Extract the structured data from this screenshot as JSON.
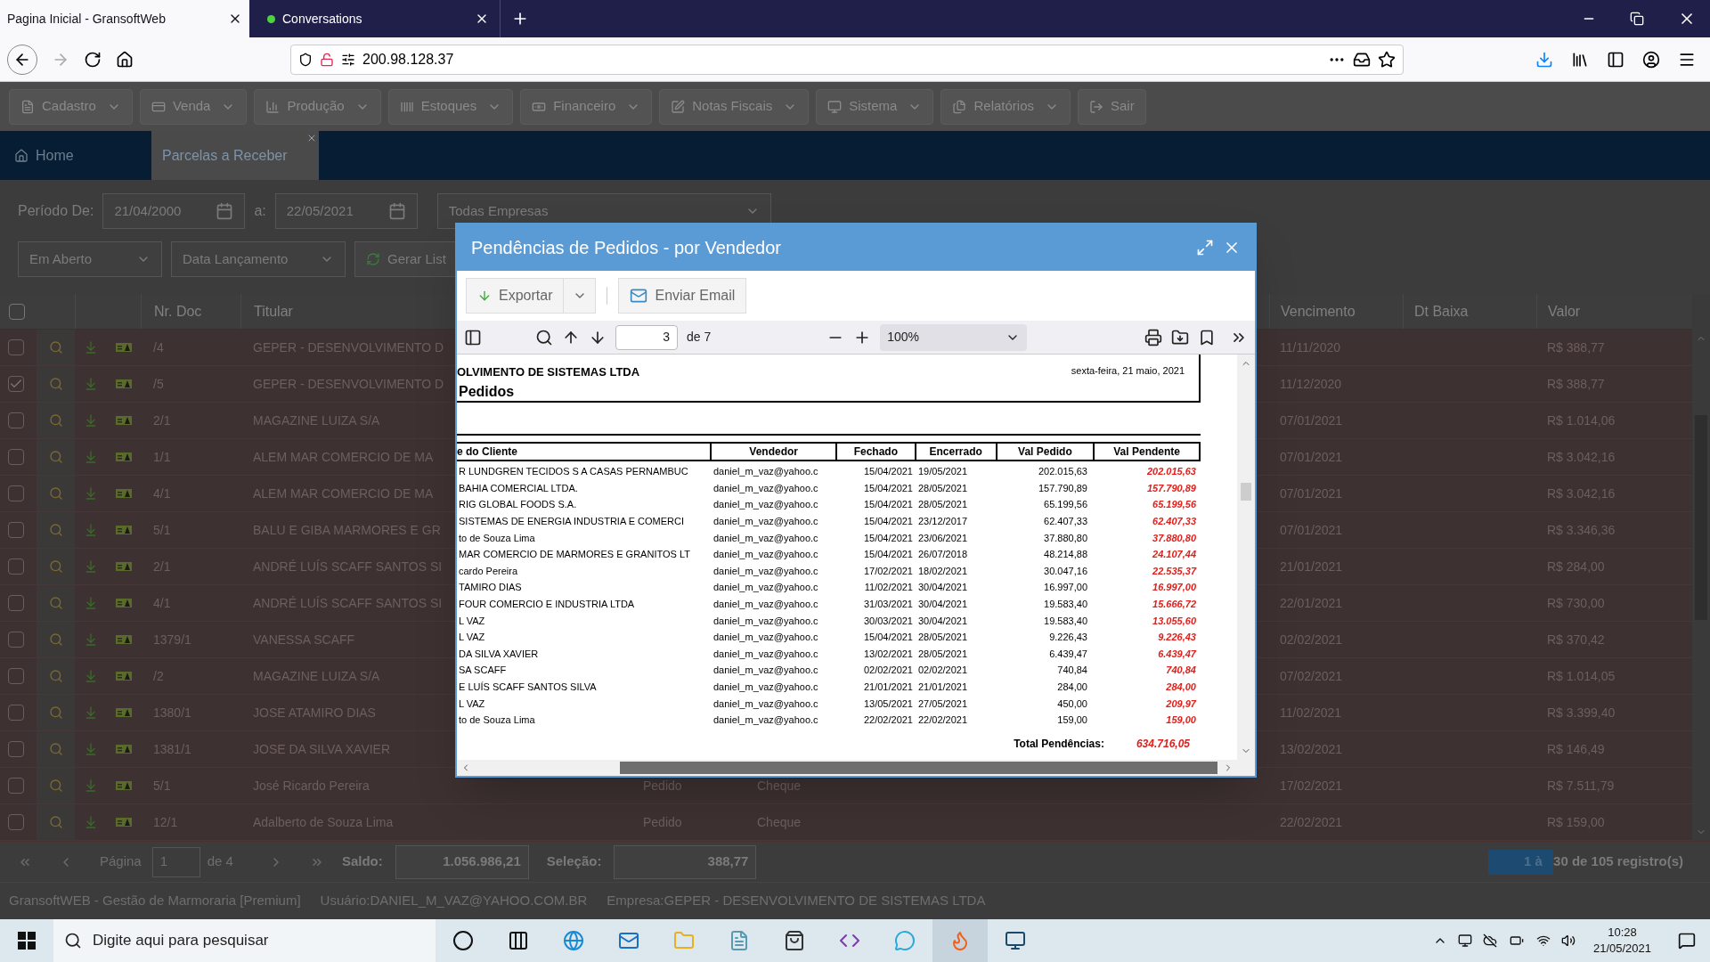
{
  "browser": {
    "tabs": [
      {
        "title": "Pagina Inicial - GransoftWeb",
        "selected": true
      },
      {
        "title": "Conversations",
        "selected": false
      }
    ],
    "address": "200.98.128.37"
  },
  "menu": [
    {
      "label": "Cadastro",
      "dropdown": true
    },
    {
      "label": "Venda",
      "dropdown": true
    },
    {
      "label": "Produção",
      "dropdown": true
    },
    {
      "label": "Estoques",
      "dropdown": true
    },
    {
      "label": "Financeiro",
      "dropdown": true
    },
    {
      "label": "Notas Fiscais",
      "dropdown": true
    },
    {
      "label": "Sistema",
      "dropdown": true
    },
    {
      "label": "Relatórios",
      "dropdown": true
    },
    {
      "label": "Sair",
      "dropdown": false
    }
  ],
  "app_tabs": [
    {
      "label": "Home",
      "selected": false,
      "closable": false
    },
    {
      "label": "Parcelas a Receber",
      "selected": true,
      "closable": true
    }
  ],
  "filters": {
    "period_label": "Período De:",
    "date_from": "21/04/2000",
    "to_label": "a:",
    "date_to": "22/05/2021",
    "company": "Todas Empresas",
    "status": "Em Aberto",
    "date_type": "Data Lançamento",
    "generate_button": "Gerar List"
  },
  "table": {
    "select_all": false,
    "columns": {
      "doc": "Nr. Doc",
      "titular": "Titular",
      "vencimento": "Vencimento",
      "baixa": "Dt Baixa",
      "valor": "Valor"
    },
    "rows": [
      {
        "checked": false,
        "doc": "/4",
        "titular": "GEPER - DESENVOLVIMENTO D",
        "vencimento": "11/11/2020",
        "valor": "R$ 388,77"
      },
      {
        "checked": true,
        "doc": "/5",
        "titular": "GEPER - DESENVOLVIMENTO D",
        "vencimento": "11/12/2020",
        "valor": "R$ 388,77"
      },
      {
        "checked": false,
        "doc": "2/1",
        "titular": "MAGAZINE LUIZA S/A",
        "vencimento": "07/01/2021",
        "valor": "R$ 1.014,06"
      },
      {
        "checked": false,
        "doc": "1/1",
        "titular": "ALEM MAR COMERCIO DE MA",
        "vencimento": "07/01/2021",
        "valor": "R$ 3.042,16"
      },
      {
        "checked": false,
        "doc": "4/1",
        "titular": "ALEM MAR COMERCIO DE MA",
        "vencimento": "07/01/2021",
        "valor": "R$ 3.042,16"
      },
      {
        "checked": false,
        "doc": "5/1",
        "titular": "BALU E GIBA MARMORES E GR",
        "vencimento": "07/01/2021",
        "valor": "R$ 3.346,36"
      },
      {
        "checked": false,
        "doc": "2/1",
        "titular": "ANDRÉ LUÍS SCAFF SANTOS SI",
        "vencimento": "21/01/2021",
        "valor": "R$ 284,00"
      },
      {
        "checked": false,
        "doc": "4/1",
        "titular": "ANDRÉ LUÍS SCAFF SANTOS SI",
        "vencimento": "22/01/2021",
        "valor": "R$ 730,00"
      },
      {
        "checked": false,
        "doc": "1379/1",
        "titular": "VANESSA SCAFF",
        "vencimento": "02/02/2021",
        "valor": "R$ 370,42"
      },
      {
        "checked": false,
        "doc": "/2",
        "titular": "MAGAZINE LUIZA S/A",
        "vencimento": "07/02/2021",
        "valor": "R$ 1.014,05"
      },
      {
        "checked": false,
        "doc": "1380/1",
        "titular": "JOSE ATAMIRO DIAS",
        "vencimento": "11/02/2021",
        "valor": "R$ 3.399,40"
      },
      {
        "checked": false,
        "doc": "1381/1",
        "titular": "JOSE DA SILVA XAVIER",
        "vencimento": "13/02/2021",
        "valor": "R$ 146,49"
      },
      {
        "checked": false,
        "doc": "5/1",
        "titular": "José Ricardo Pereira",
        "column_5": "Pedido",
        "column_6": "Cheque",
        "vencimento": "17/02/2021",
        "valor": "R$ 7.511,79"
      },
      {
        "checked": false,
        "doc": "12/1",
        "titular": "Adalberto de Souza Lima",
        "column_5": "Pedido",
        "column_6": "Cheque",
        "vencimento": "22/02/2021",
        "valor": "R$ 159,00"
      }
    ]
  },
  "pager": {
    "page_label": "Página",
    "page": "1",
    "page_count": "de 4",
    "balance_label": "Saldo:",
    "balance": "1.056.986,21",
    "selection_label": "Seleção:",
    "selection": "388,77",
    "records_highlight": "1 à",
    "records": "30 de 105 registro(s)"
  },
  "status_bar": [
    "GransoftWEB - Gestão de Marmoraria [Premium]",
    "Usuário:DANIEL_M_VAZ@YAHOO.COM.BR",
    "Empresa:GEPER - DESENVOLVIMENTO DE SISTEMAS LTDA"
  ],
  "modal": {
    "title": "Pendências de Pedidos - por Vendedor",
    "export_button": "Exportar",
    "email_button": "Enviar Email",
    "viewer": {
      "page": "3",
      "page_count": "de 7",
      "zoom": "100%"
    },
    "report": {
      "company": "OLVIMENTO DE SISTEMAS LTDA",
      "title": "Pedidos",
      "date": "sexta-feira, 21 maio, 2021",
      "columns": [
        "e do Cliente",
        "Vendedor",
        "Fechado",
        "Encerrado",
        "Val Pedido",
        "Val Pendente"
      ],
      "rows": [
        [
          "R LUNDGREN TECIDOS S A CASAS PERNAMBUC",
          "daniel_m_vaz@yahoo.c",
          "15/04/2021",
          "19/05/2021",
          "202.015,63",
          "202.015,63"
        ],
        [
          "BAHIA COMERCIAL LTDA.",
          "daniel_m_vaz@yahoo.c",
          "15/04/2021",
          "28/05/2021",
          "157.790,89",
          "157.790,89"
        ],
        [
          "RIG GLOBAL FOODS S.A.",
          "daniel_m_vaz@yahoo.c",
          "15/04/2021",
          "28/05/2021",
          "65.199,56",
          "65.199,56"
        ],
        [
          "SISTEMAS DE ENERGIA INDUSTRIA E COMERCI",
          "daniel_m_vaz@yahoo.c",
          "15/04/2021",
          "23/12/2017",
          "62.407,33",
          "62.407,33"
        ],
        [
          "to de Souza Lima",
          "daniel_m_vaz@yahoo.c",
          "15/04/2021",
          "23/06/2021",
          "37.880,80",
          "37.880,80"
        ],
        [
          "MAR COMERCIO DE MARMORES E GRANITOS LT",
          "daniel_m_vaz@yahoo.c",
          "15/04/2021",
          "26/07/2018",
          "48.214,88",
          "24.107,44"
        ],
        [
          "cardo Pereira",
          "daniel_m_vaz@yahoo.c",
          "17/02/2021",
          "18/02/2021",
          "30.047,16",
          "22.535,37"
        ],
        [
          "TAMIRO DIAS",
          "daniel_m_vaz@yahoo.c",
          "11/02/2021",
          "30/04/2021",
          "16.997,00",
          "16.997,00"
        ],
        [
          "FOUR COMERCIO E INDUSTRIA LTDA",
          "daniel_m_vaz@yahoo.c",
          "31/03/2021",
          "30/04/2021",
          "19.583,40",
          "15.666,72"
        ],
        [
          "L VAZ",
          "daniel_m_vaz@yahoo.c",
          "30/03/2021",
          "30/04/2021",
          "19.583,40",
          "13.055,60"
        ],
        [
          "L VAZ",
          "daniel_m_vaz@yahoo.c",
          "15/04/2021",
          "28/05/2021",
          "9.226,43",
          "9.226,43"
        ],
        [
          "DA SILVA XAVIER",
          "daniel_m_vaz@yahoo.c",
          "13/02/2021",
          "28/05/2021",
          "6.439,47",
          "6.439,47"
        ],
        [
          "SA SCAFF",
          "daniel_m_vaz@yahoo.c",
          "02/02/2021",
          "02/02/2021",
          "740,84",
          "740,84"
        ],
        [
          "E LUÍS SCAFF SANTOS SILVA",
          "daniel_m_vaz@yahoo.c",
          "21/01/2021",
          "21/01/2021",
          "284,00",
          "284,00"
        ],
        [
          "L VAZ",
          "daniel_m_vaz@yahoo.c",
          "13/05/2021",
          "27/05/2021",
          "450,00",
          "209,97"
        ],
        [
          "to de Souza Lima",
          "daniel_m_vaz@yahoo.c",
          "22/02/2021",
          "22/02/2021",
          "159,00",
          "159,00"
        ]
      ],
      "total_label": "Total Pendências:",
      "total": "634.716,05"
    }
  },
  "taskbar": {
    "search_placeholder": "Digite aqui para pesquisar",
    "time": "10:28",
    "date": "21/05/2021"
  }
}
